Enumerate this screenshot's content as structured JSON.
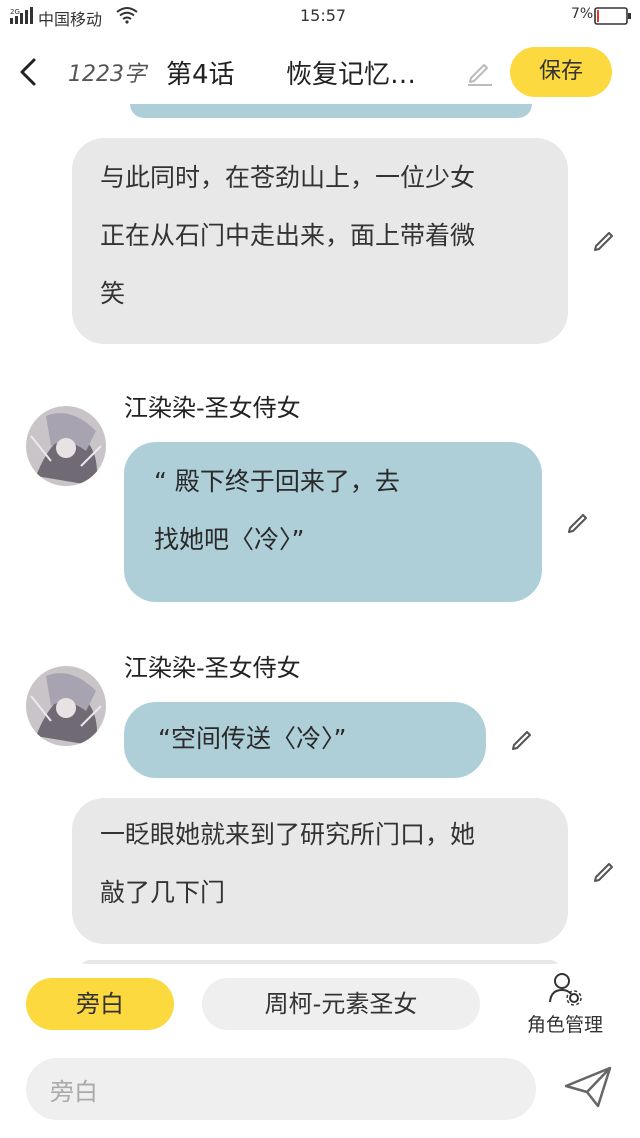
{
  "status_bar": {
    "carrier": "中国移动",
    "time": "15:57",
    "battery_percent": "7%",
    "network": "2G",
    "battery_level": 0.07,
    "battery_color": "#e53935"
  },
  "header": {
    "word_count": "1223字",
    "chapter_no": "第4话",
    "chapter_title": "恢复记忆…",
    "save_label": "保存"
  },
  "messages": [
    {
      "kind": "narration",
      "text_lines": [
        "与此同时，在苍劲山上，一位少女",
        "正在从石门中走出来，面上带着微",
        "笑"
      ]
    },
    {
      "kind": "speech",
      "speaker": "江染染-圣女侍女",
      "text_lines": [
        "“ 殿下终于回来了，去",
        "找她吧〈冷〉”"
      ]
    },
    {
      "kind": "speech",
      "speaker": "江染染-圣女侍女",
      "text_lines": [
        "“空间传送〈冷〉”"
      ]
    },
    {
      "kind": "narration",
      "text_lines": [
        "一眨眼她就来到了研究所门口，她",
        "敲了几下门"
      ]
    }
  ],
  "bottom": {
    "chip_narration": "旁白",
    "chip_character": "周柯-元素圣女",
    "manage_label": "角色管理",
    "input_placeholder": "旁白"
  },
  "colors": {
    "accent": "#fcd93f",
    "narration_bubble": "#e8e8e8",
    "speech_bubble": "#aecfd8"
  }
}
